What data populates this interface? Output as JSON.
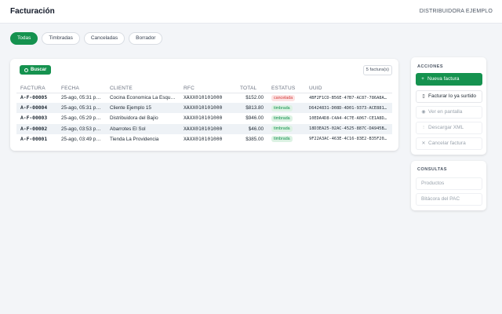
{
  "header": {
    "title": "Facturación",
    "company": "DISTRIBUIDORA EJEMPLO"
  },
  "tabs": [
    {
      "label": "Todas",
      "active": true
    },
    {
      "label": "Timbradas",
      "active": false
    },
    {
      "label": "Canceladas",
      "active": false
    },
    {
      "label": "Borrador",
      "active": false
    }
  ],
  "toolbar": {
    "search_label": "Buscar",
    "count_text": "5 factura(s)"
  },
  "table": {
    "columns": [
      "FACTURA",
      "FECHA",
      "CLIENTE",
      "RFC",
      "TOTAL",
      "ESTATUS",
      "UUID"
    ],
    "rows": [
      {
        "factura": "A-F-00005",
        "fecha": "25-ago, 05:31 p.m.",
        "cliente": "Cocina Economica La Esquina",
        "rfc": "XAXX010101000",
        "total": "$152.00",
        "estatus": "cancelada",
        "uuid": "4BF2F1CD-B56E-47B7-AC87-786A8A3..."
      },
      {
        "factura": "A-F-00004",
        "fecha": "25-ago, 05:31 p.m.",
        "cliente": "Cliente Ejemplo 15",
        "rfc": "XAXX010101000",
        "total": "$813.80",
        "estatus": "timbrada",
        "uuid": "D6424831-D08D-4D01-9373-ACE8816..."
      },
      {
        "factura": "A-F-00003",
        "fecha": "25-ago, 05:29 p.m.",
        "cliente": "Distribuidora del Bajío",
        "rfc": "XAXX010101000",
        "total": "$946.00",
        "estatus": "timbrada",
        "uuid": "10EDA4D8-C4A4-4C7E-A067-CE1A8D6..."
      },
      {
        "factura": "A-F-00002",
        "fecha": "25-ago, 03:53 p.m.",
        "cliente": "Abarrotes El Sol",
        "rfc": "XAXX010101000",
        "total": "$46.00",
        "estatus": "timbrada",
        "uuid": "18D3EA25-02AC-4525-887C-DA945B3..."
      },
      {
        "factura": "A-F-00001",
        "fecha": "25-ago, 03:49 p.m.",
        "cliente": "Tienda La Providencia",
        "rfc": "XAXX010101000",
        "total": "$385.00",
        "estatus": "timbrada",
        "uuid": "9F22A3AC-463E-4C16-83E2-B35F209..."
      }
    ]
  },
  "actions": {
    "heading": "ACCIONES",
    "items": [
      {
        "label": "Nueva factura",
        "icon": "+",
        "style": "primary"
      },
      {
        "label": "Facturar lo ya surtido",
        "icon": "▯",
        "style": "normal"
      },
      {
        "label": "Ver en pantalla",
        "icon": "◉",
        "style": "disabled"
      },
      {
        "label": "Descargar XML",
        "icon": "⫶",
        "style": "disabled"
      },
      {
        "label": "Cancelar factura",
        "icon": "✕",
        "style": "disabled"
      }
    ]
  },
  "queries": {
    "heading": "CONSULTAS",
    "items": [
      {
        "label": "Productos"
      },
      {
        "label": "Bitácora del PAC"
      }
    ]
  },
  "colors": {
    "accent": "#15924f",
    "cancelled": "#d23b3b",
    "stamped": "#15924f"
  }
}
